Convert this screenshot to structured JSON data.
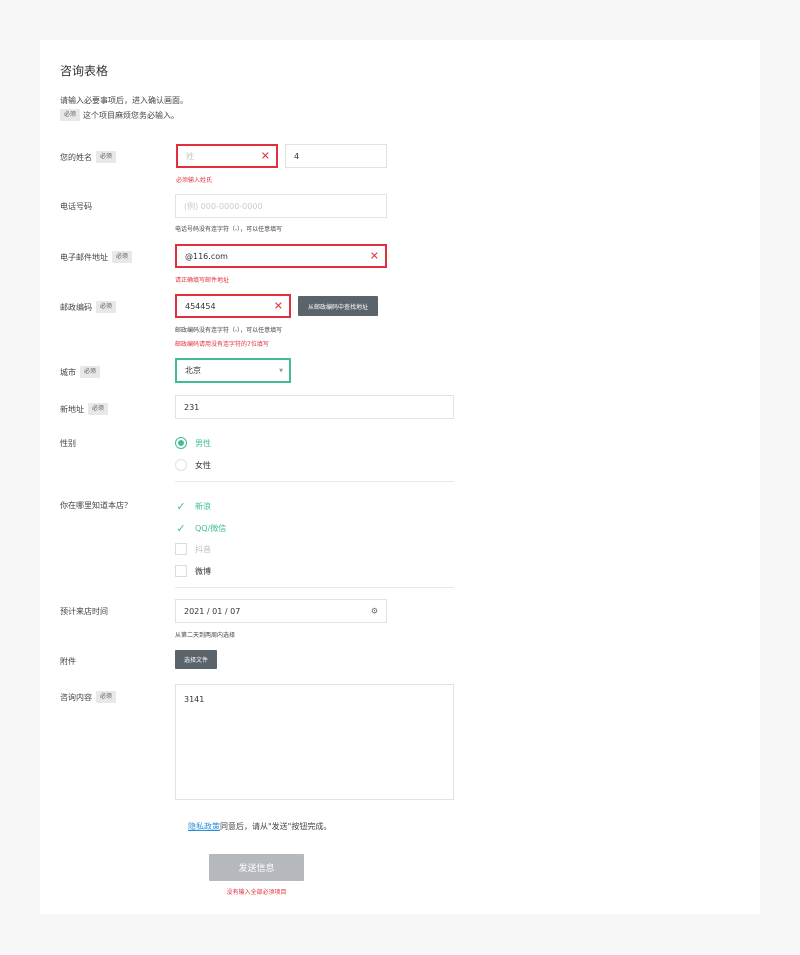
{
  "form": {
    "title": "咨询表格",
    "intro_line1": "请输入必要事项后，进入确认画面。",
    "intro_line2": "这个项目麻烦您务必输入。",
    "required_badge": "必须"
  },
  "name": {
    "label": "您的姓名",
    "last_placeholder": "姓",
    "first_value": "4",
    "error": "必须输入姓氏"
  },
  "phone": {
    "label": "电话号码",
    "placeholder": "(例) 000-0000-0000",
    "hint": "电话号码没有连字符（-），可以任意填写"
  },
  "email": {
    "label": "电子邮件地址",
    "value": "@116.com",
    "error": "请正确填写邮件地址"
  },
  "postal": {
    "label": "邮政编码",
    "value": "454454",
    "lookup_button": "从邮政编码中查找地址",
    "hint": "邮政编码没有连字符（-），可以任意填写",
    "error": "邮政编码请用没有连字符的7位填写"
  },
  "city": {
    "label": "城市",
    "selected": "北京"
  },
  "address": {
    "label": "新地址",
    "value": "231"
  },
  "gender": {
    "label": "性别",
    "options": [
      "男性",
      "女性"
    ]
  },
  "source": {
    "label": "你在哪里知道本店？",
    "options": [
      "新浪",
      "QQ/微信",
      "抖音",
      "微博"
    ]
  },
  "visit": {
    "label": "预计来店时间",
    "value": "2021 / 01 / 07",
    "hint": "从第二天到两周内选择"
  },
  "attachment": {
    "label": "附件",
    "button": "选择文件"
  },
  "content": {
    "label": "咨询内容",
    "value": "3141"
  },
  "privacy": {
    "link": "隐私政策",
    "text": "同意后，请从\"发送\"按钮完成。"
  },
  "submit": {
    "label": "发送信息",
    "error": "没有输入全部必须项目"
  },
  "colors": {
    "error": "#e0303d",
    "accent": "#3fbf8f",
    "dark_button": "#5b636b"
  }
}
